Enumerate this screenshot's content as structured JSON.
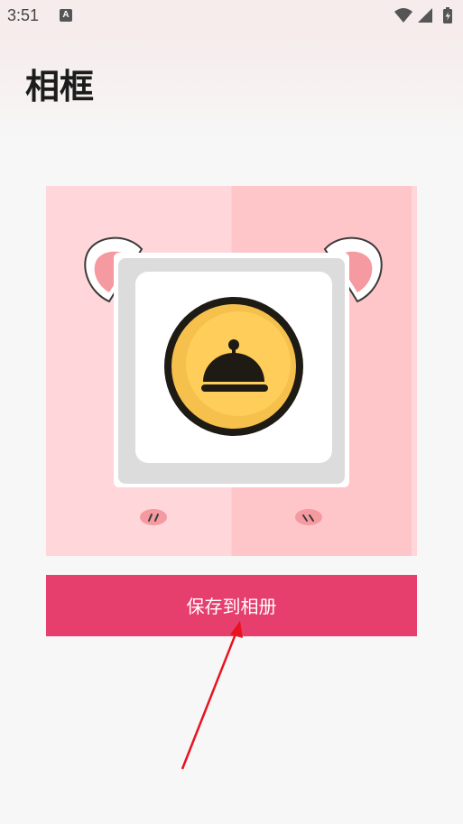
{
  "status_bar": {
    "time": "3:51",
    "notification_letter": "A",
    "icons": [
      "wifi-icon",
      "signal-icon",
      "battery-icon"
    ]
  },
  "header": {
    "title": "相框"
  },
  "preview": {
    "icon": "cloche-icon",
    "colors": {
      "background_left": "#ffd6d9",
      "background_right": "#ffc6c9",
      "coin_fill": "#ffcd5a",
      "coin_border": "#1e1a14"
    }
  },
  "actions": {
    "save_label": "保存到相册",
    "save_color": "#e63e6d"
  },
  "annotation": {
    "arrow_color": "#e8131f"
  }
}
